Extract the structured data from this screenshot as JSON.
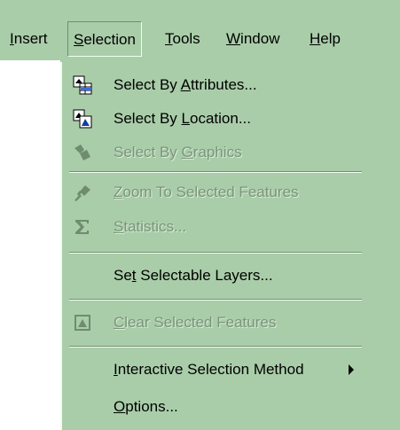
{
  "menubar": {
    "items": [
      {
        "pre": "",
        "u": "I",
        "post": "nsert"
      },
      {
        "pre": "",
        "u": "S",
        "post": "election"
      },
      {
        "pre": "",
        "u": "T",
        "post": "ools"
      },
      {
        "pre": "",
        "u": "W",
        "post": "indow"
      },
      {
        "pre": "",
        "u": "H",
        "post": "elp"
      }
    ]
  },
  "selection_menu": {
    "select_by_attributes": {
      "pre": "Select By ",
      "u": "A",
      "post": "ttributes...",
      "icon": "select-by-attributes-icon"
    },
    "select_by_location": {
      "pre": "Select By ",
      "u": "L",
      "post": "ocation...",
      "icon": "select-by-location-icon"
    },
    "select_by_graphics": {
      "pre": "Select By ",
      "u": "G",
      "post": "raphics",
      "icon": "select-by-graphics-icon"
    },
    "zoom_to_selected": {
      "pre": "",
      "u": "Z",
      "post": "oom To Selected Features",
      "icon": "zoom-to-selected-icon"
    },
    "statistics": {
      "pre": "",
      "u": "S",
      "post": "tatistics...",
      "icon": "sigma-icon"
    },
    "set_selectable_layers": {
      "pre": "Se",
      "u": "t",
      "post": " Selectable Layers..."
    },
    "clear_selected": {
      "pre": "",
      "u": "C",
      "post": "lear Selected Features",
      "icon": "clear-selection-icon"
    },
    "interactive_method": {
      "pre": "",
      "u": "I",
      "post": "nteractive Selection Method"
    },
    "options": {
      "pre": "",
      "u": "O",
      "post": "ptions..."
    }
  },
  "colors": {
    "menu_bg": "#a9cda9",
    "disabled_text": "#7a947a"
  }
}
